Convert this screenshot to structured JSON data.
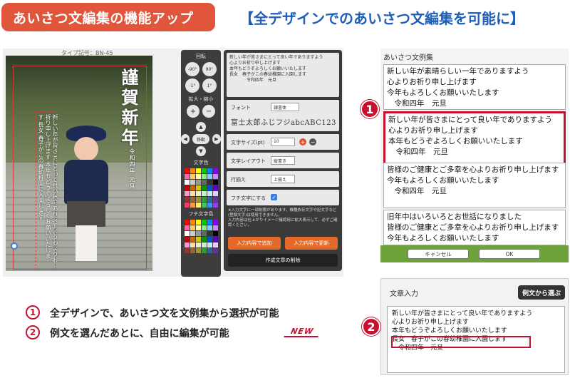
{
  "header": {
    "badge": "あいさつ文編集の機能アップ",
    "title": "【全デザインでのあいさつ文編集を可能に】"
  },
  "editor": {
    "type_code": "タイプ記号：BN-45",
    "card": {
      "greeting": "謹賀新年",
      "greeting_sub": "令和四年 元旦",
      "body_text": "新しい年が皆さまにとって良い年でありますよう心よりお祈り申し上げます 本年もどうぞよろしくお願いいたします 長女 春子がこの春幼稚園に入園します"
    },
    "tools": {
      "rotate_label": "回転",
      "rotate_buttons": [
        "-90°",
        "90°",
        "-1°",
        "1°"
      ],
      "zoom_label": "拡大・縮小",
      "zoom_in": "+",
      "zoom_out": "−",
      "move_label": "移動",
      "text_color_label": "文字色",
      "outline_color_label": "フチ文字色",
      "text_colors": [
        "#ff0000",
        "#ff8800",
        "#ffff00",
        "#00cc00",
        "#0088ff",
        "#8800ff",
        "#ff66aa",
        "#ffcc66",
        "#ffffaa",
        "#88ee88",
        "#88ccff",
        "#cc88ff",
        "#ffffff",
        "#cccccc",
        "#999999",
        "#666666",
        "#333333",
        "#000000",
        "#cc0000",
        "#cc6600",
        "#cccc00",
        "#009900",
        "#0055cc",
        "#6600cc",
        "#ff99cc",
        "#ffddaa",
        "#eeeecc",
        "#cceecc",
        "#cce6ff",
        "#e6ccff",
        "#993333",
        "#996633",
        "#999933",
        "#339933",
        "#336699",
        "#663399",
        "#ff3366",
        "#ff9933",
        "#ffee55",
        "#33cc66",
        "#3399ff",
        "#9933ff"
      ],
      "outline_colors": [
        "#ff0000",
        "#ff8800",
        "#ffff00",
        "#00cc00",
        "#0088ff",
        "#8800ff",
        "#ff66aa",
        "#ffcc66",
        "#ffffaa",
        "#88ee88",
        "#88ccff",
        "#cc88ff",
        "#ffffff",
        "#cccccc",
        "#999999",
        "#666666",
        "#333333",
        "#000000",
        "#cc0000",
        "#cc6600",
        "#cccc00",
        "#009900",
        "#0055cc",
        "#6600cc",
        "#ff99cc",
        "#ffddaa",
        "#eeeecc",
        "#cceecc",
        "#cce6ff",
        "#e6ccff",
        "#993333",
        "#996633",
        "#999933",
        "#339933",
        "#336699",
        "#663399"
      ]
    },
    "form": {
      "text_preview": "新しい年が皆さまにとって良い年でありますよう\n心よりお祈り申し上げます\n本年もどうぞよろしくお願いいたします\n長女　春子がこの春幼稚園に入園します\n　　　　令和四年　元旦",
      "font_label": "フォント",
      "font_value": "隷書体",
      "font_preview": "富士太郎ふじフジabcABC123",
      "size_label": "文字サイズ(pt)",
      "size_value": "10",
      "size_plus": "+",
      "size_minus": "−",
      "layout_label": "文字レイアウト",
      "layout_value": "縦書き",
      "align_label": "行揃え",
      "align_value": "上揃え",
      "outline_label": "フチ文字にする",
      "outline_checked": "✓",
      "note": "※入力文字に一部制限があります。機種依存文字や記文字など(登録文字)は使用できません。\n入力内容は仕上がりイメージ確認用に拡大表示して、必ずご確認ください。",
      "add_button": "入力内容で追加",
      "update_button": "入力内容で更新",
      "delete_button": "作成文章の削除"
    }
  },
  "samples": {
    "title": "あいさつ文例集",
    "items": [
      "新しい年が素晴らしい一年でありますよう\n心よりお祈り申し上げます\n今年もよろしくお願いいたします\n　令和四年　元旦",
      "新しい年が皆さまにとって良い年でありますよう\n心よりお祈り申し上げます\n本年もどうぞよろしくお願いいたします\n　令和四年　元旦",
      "皆様のご健康とご多幸を心よりお祈り申し上げます\n今年もよろしくお願いいたします\n　令和四年　元旦",
      "旧年中はいろいろとお世話になりました\n皆様のご健康とご多幸を心よりお祈り申し上げます\n今年もよろしくお願いいたします"
    ],
    "cancel_button": "キャンセル",
    "ok_button": "OK"
  },
  "callouts": {
    "one": "1",
    "two": "2"
  },
  "bullets": [
    {
      "num": "1",
      "text": "全デザインで、あいさつ文を文例集から選択が可能"
    },
    {
      "num": "2",
      "text": "例文を選んだあとに、自由に編集が可能"
    }
  ],
  "new_badge": "NEW",
  "input_panel": {
    "title": "文章入力",
    "choose_button": "例文から選ぶ",
    "text": "新しい年が皆さまにとって良い年でありますよう\n心よりお祈り申し上げます\n本年もどうぞよろしくお願いいたします\n長女　春子がこの春幼稚園に入園します\n　令和四年　元旦"
  }
}
